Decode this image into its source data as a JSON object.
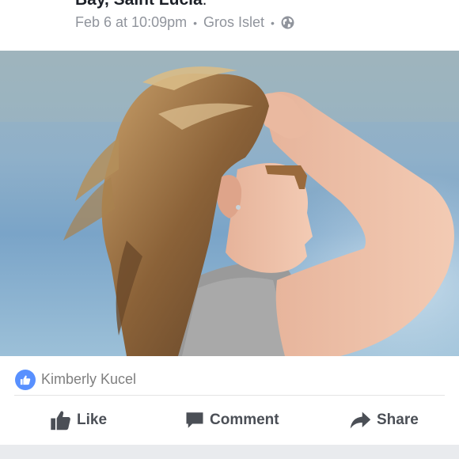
{
  "post": {
    "place_bold": "Bay, Saint Lucia",
    "place_trail": ".",
    "date": "Feb 6 at 10:09pm",
    "separator": "•",
    "location": "Gros Islet",
    "privacy_icon": "globe-icon"
  },
  "reactions": {
    "icon": "like-badge-icon",
    "name": "Kimberly Kucel"
  },
  "actions": {
    "like": {
      "label": "Like",
      "icon": "thumbs-up-icon"
    },
    "comment": {
      "label": "Comment",
      "icon": "comment-icon"
    },
    "share": {
      "label": "Share",
      "icon": "share-icon"
    }
  },
  "colors": {
    "text_dark": "#1d2129",
    "meta_gray": "#90949c",
    "action_gray": "#4b4f56",
    "like_blue": "#5890ff",
    "background_gap": "#e9ebee"
  }
}
